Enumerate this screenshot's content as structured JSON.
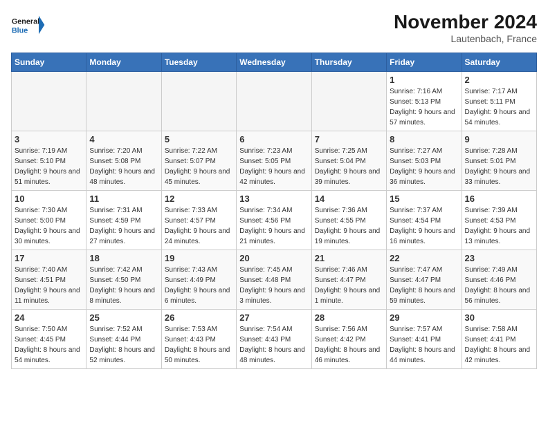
{
  "logo": {
    "line1": "General",
    "line2": "Blue"
  },
  "title": "November 2024",
  "location": "Lautenbach, France",
  "days_of_week": [
    "Sunday",
    "Monday",
    "Tuesday",
    "Wednesday",
    "Thursday",
    "Friday",
    "Saturday"
  ],
  "weeks": [
    [
      {
        "day": "",
        "info": ""
      },
      {
        "day": "",
        "info": ""
      },
      {
        "day": "",
        "info": ""
      },
      {
        "day": "",
        "info": ""
      },
      {
        "day": "",
        "info": ""
      },
      {
        "day": "1",
        "info": "Sunrise: 7:16 AM\nSunset: 5:13 PM\nDaylight: 9 hours and 57 minutes."
      },
      {
        "day": "2",
        "info": "Sunrise: 7:17 AM\nSunset: 5:11 PM\nDaylight: 9 hours and 54 minutes."
      }
    ],
    [
      {
        "day": "3",
        "info": "Sunrise: 7:19 AM\nSunset: 5:10 PM\nDaylight: 9 hours and 51 minutes."
      },
      {
        "day": "4",
        "info": "Sunrise: 7:20 AM\nSunset: 5:08 PM\nDaylight: 9 hours and 48 minutes."
      },
      {
        "day": "5",
        "info": "Sunrise: 7:22 AM\nSunset: 5:07 PM\nDaylight: 9 hours and 45 minutes."
      },
      {
        "day": "6",
        "info": "Sunrise: 7:23 AM\nSunset: 5:05 PM\nDaylight: 9 hours and 42 minutes."
      },
      {
        "day": "7",
        "info": "Sunrise: 7:25 AM\nSunset: 5:04 PM\nDaylight: 9 hours and 39 minutes."
      },
      {
        "day": "8",
        "info": "Sunrise: 7:27 AM\nSunset: 5:03 PM\nDaylight: 9 hours and 36 minutes."
      },
      {
        "day": "9",
        "info": "Sunrise: 7:28 AM\nSunset: 5:01 PM\nDaylight: 9 hours and 33 minutes."
      }
    ],
    [
      {
        "day": "10",
        "info": "Sunrise: 7:30 AM\nSunset: 5:00 PM\nDaylight: 9 hours and 30 minutes."
      },
      {
        "day": "11",
        "info": "Sunrise: 7:31 AM\nSunset: 4:59 PM\nDaylight: 9 hours and 27 minutes."
      },
      {
        "day": "12",
        "info": "Sunrise: 7:33 AM\nSunset: 4:57 PM\nDaylight: 9 hours and 24 minutes."
      },
      {
        "day": "13",
        "info": "Sunrise: 7:34 AM\nSunset: 4:56 PM\nDaylight: 9 hours and 21 minutes."
      },
      {
        "day": "14",
        "info": "Sunrise: 7:36 AM\nSunset: 4:55 PM\nDaylight: 9 hours and 19 minutes."
      },
      {
        "day": "15",
        "info": "Sunrise: 7:37 AM\nSunset: 4:54 PM\nDaylight: 9 hours and 16 minutes."
      },
      {
        "day": "16",
        "info": "Sunrise: 7:39 AM\nSunset: 4:53 PM\nDaylight: 9 hours and 13 minutes."
      }
    ],
    [
      {
        "day": "17",
        "info": "Sunrise: 7:40 AM\nSunset: 4:51 PM\nDaylight: 9 hours and 11 minutes."
      },
      {
        "day": "18",
        "info": "Sunrise: 7:42 AM\nSunset: 4:50 PM\nDaylight: 9 hours and 8 minutes."
      },
      {
        "day": "19",
        "info": "Sunrise: 7:43 AM\nSunset: 4:49 PM\nDaylight: 9 hours and 6 minutes."
      },
      {
        "day": "20",
        "info": "Sunrise: 7:45 AM\nSunset: 4:48 PM\nDaylight: 9 hours and 3 minutes."
      },
      {
        "day": "21",
        "info": "Sunrise: 7:46 AM\nSunset: 4:47 PM\nDaylight: 9 hours and 1 minute."
      },
      {
        "day": "22",
        "info": "Sunrise: 7:47 AM\nSunset: 4:47 PM\nDaylight: 8 hours and 59 minutes."
      },
      {
        "day": "23",
        "info": "Sunrise: 7:49 AM\nSunset: 4:46 PM\nDaylight: 8 hours and 56 minutes."
      }
    ],
    [
      {
        "day": "24",
        "info": "Sunrise: 7:50 AM\nSunset: 4:45 PM\nDaylight: 8 hours and 54 minutes."
      },
      {
        "day": "25",
        "info": "Sunrise: 7:52 AM\nSunset: 4:44 PM\nDaylight: 8 hours and 52 minutes."
      },
      {
        "day": "26",
        "info": "Sunrise: 7:53 AM\nSunset: 4:43 PM\nDaylight: 8 hours and 50 minutes."
      },
      {
        "day": "27",
        "info": "Sunrise: 7:54 AM\nSunset: 4:43 PM\nDaylight: 8 hours and 48 minutes."
      },
      {
        "day": "28",
        "info": "Sunrise: 7:56 AM\nSunset: 4:42 PM\nDaylight: 8 hours and 46 minutes."
      },
      {
        "day": "29",
        "info": "Sunrise: 7:57 AM\nSunset: 4:41 PM\nDaylight: 8 hours and 44 minutes."
      },
      {
        "day": "30",
        "info": "Sunrise: 7:58 AM\nSunset: 4:41 PM\nDaylight: 8 hours and 42 minutes."
      }
    ]
  ]
}
